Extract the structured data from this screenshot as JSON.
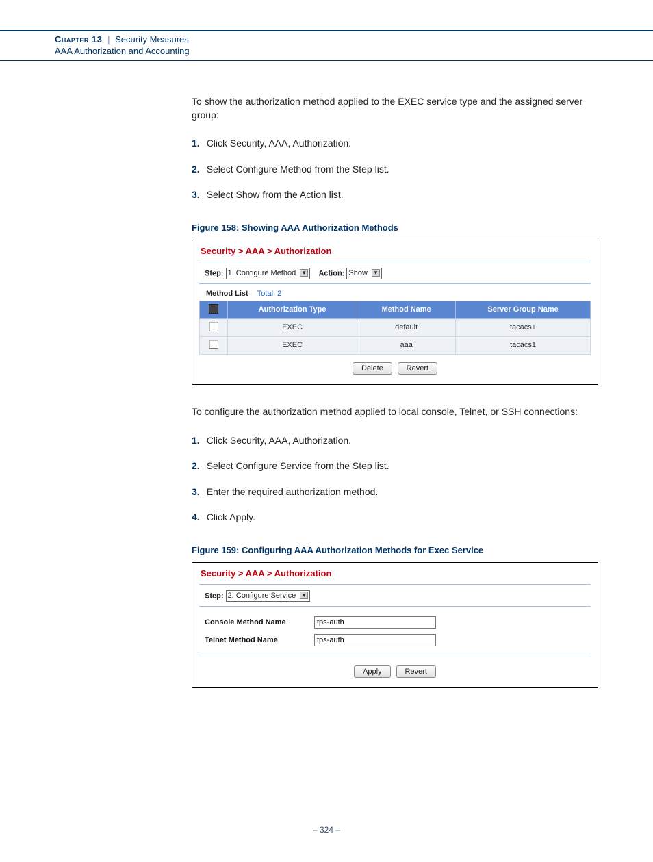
{
  "header": {
    "chapter": "Chapter 13",
    "section": "Security Measures",
    "subsection": "AAA Authorization and Accounting"
  },
  "intro1": "To show the authorization method applied to the EXEC service type and the assigned server group:",
  "steps1": {
    "s1": "Click Security, AAA, Authorization.",
    "s2": "Select Configure Method from the Step list.",
    "s3": "Select Show from the Action list."
  },
  "fig158": {
    "caption": "Figure 158:  Showing AAA Authorization Methods",
    "breadcrumb": "Security > AAA > Authorization",
    "step_label": "Step:",
    "step_value": "1. Configure Method",
    "action_label": "Action:",
    "action_value": "Show",
    "method_list_label": "Method List",
    "total_label": "Total: 2",
    "cols": {
      "c1": "Authorization Type",
      "c2": "Method Name",
      "c3": "Server Group Name"
    },
    "rows": [
      {
        "type": "EXEC",
        "method": "default",
        "group": "tacacs+"
      },
      {
        "type": "EXEC",
        "method": "aaa",
        "group": "tacacs1"
      }
    ],
    "btn_delete": "Delete",
    "btn_revert": "Revert"
  },
  "intro2": "To configure the authorization method applied to local console, Telnet, or SSH connections:",
  "steps2": {
    "s1": "Click Security, AAA, Authorization.",
    "s2": "Select Configure Service from the Step list.",
    "s3": "Enter the required authorization method.",
    "s4": "Click Apply."
  },
  "fig159": {
    "caption": "Figure 159:  Configuring AAA Authorization Methods for Exec Service",
    "breadcrumb": "Security > AAA > Authorization",
    "step_label": "Step:",
    "step_value": "2. Configure Service",
    "console_label": "Console Method Name",
    "console_value": "tps-auth",
    "telnet_label": "Telnet Method Name",
    "telnet_value": "tps-auth",
    "btn_apply": "Apply",
    "btn_revert": "Revert"
  },
  "page_number": "–  324  –"
}
